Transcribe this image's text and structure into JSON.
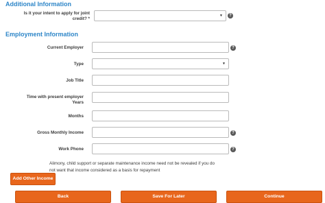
{
  "additional_info": {
    "title": "Additional Information",
    "joint_credit": {
      "label": "Is it your intent to apply for joint\ncredit? *",
      "value": ""
    }
  },
  "employment_info": {
    "title": "Employment Information",
    "fields": {
      "current_employer": {
        "label": "Current Employer",
        "value": ""
      },
      "type": {
        "label": "Type",
        "value": ""
      },
      "job_title": {
        "label": "Job Title",
        "value": ""
      },
      "time_with_employer": {
        "label": "Time with present employer\nYears",
        "value": ""
      },
      "months": {
        "label": "Months",
        "value": ""
      },
      "gross_monthly_income": {
        "label": "Gross Monthly Income",
        "value": ""
      },
      "work_phone": {
        "label": "Work Phone",
        "value": ""
      }
    },
    "alimony_note": "Alimony, child support or separate maintenance income need not be revealed if you do not want that income considered as a basis for repayment"
  },
  "icons": {
    "help": "?",
    "dropdown": "▼"
  },
  "buttons": {
    "add_other_income": "Add Other Income",
    "back": "Back",
    "save_for_later": "Save For Later",
    "continue": "Continue"
  },
  "colors": {
    "section_title": "#2e86c8",
    "button": "#e8661c"
  }
}
